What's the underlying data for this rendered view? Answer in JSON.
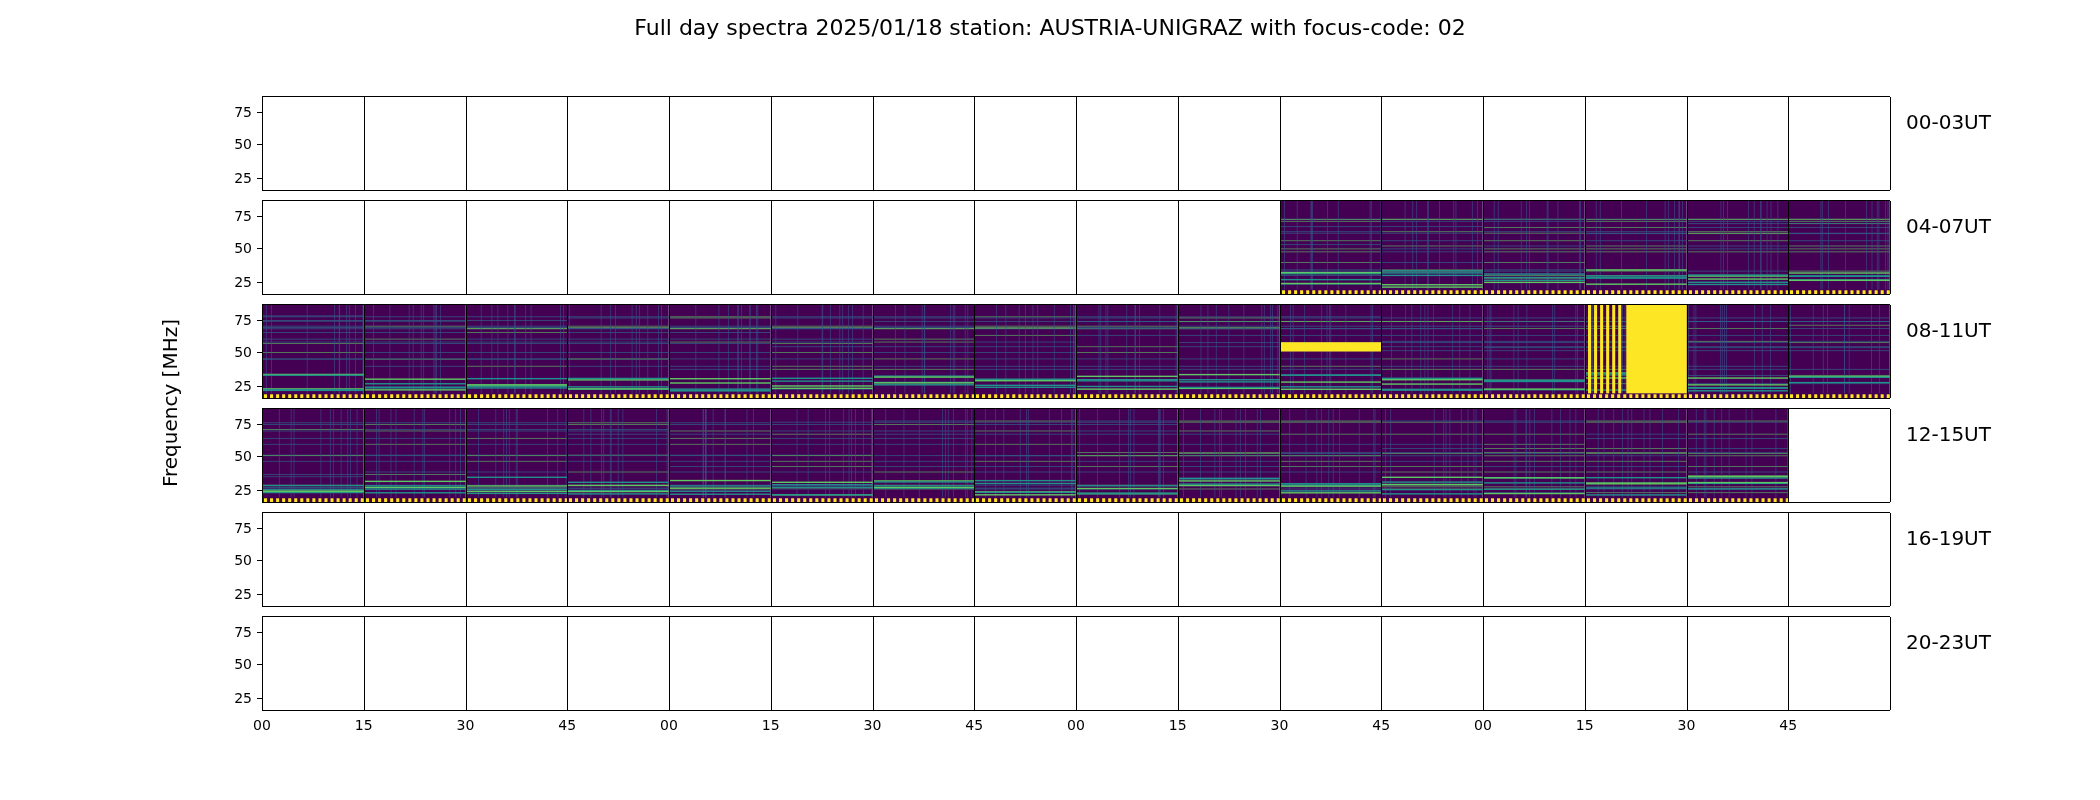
{
  "title": "Full day spectra 2025/01/18 station: AUSTRIA-UNIGRAZ with focus-code: 02",
  "ylabel": "Frequency [MHz]",
  "rows": [
    {
      "label": "00-03UT",
      "yticks": [
        "75",
        "50",
        "25"
      ],
      "panels": [
        {
          "kind": "empty"
        },
        {
          "kind": "empty"
        },
        {
          "kind": "empty"
        },
        {
          "kind": "empty"
        },
        {
          "kind": "empty"
        },
        {
          "kind": "empty"
        },
        {
          "kind": "empty"
        },
        {
          "kind": "empty"
        },
        {
          "kind": "empty"
        },
        {
          "kind": "empty"
        },
        {
          "kind": "empty"
        },
        {
          "kind": "empty"
        },
        {
          "kind": "empty"
        },
        {
          "kind": "empty"
        },
        {
          "kind": "empty"
        },
        {
          "kind": "empty"
        }
      ]
    },
    {
      "label": "04-07UT",
      "yticks": [
        "75",
        "50",
        "25"
      ],
      "panels": [
        {
          "kind": "empty"
        },
        {
          "kind": "empty"
        },
        {
          "kind": "empty"
        },
        {
          "kind": "empty"
        },
        {
          "kind": "empty"
        },
        {
          "kind": "empty"
        },
        {
          "kind": "empty"
        },
        {
          "kind": "empty"
        },
        {
          "kind": "empty"
        },
        {
          "kind": "empty"
        },
        {
          "kind": "spectrum"
        },
        {
          "kind": "spectrum"
        },
        {
          "kind": "spectrum"
        },
        {
          "kind": "spectrum"
        },
        {
          "kind": "spectrum"
        },
        {
          "kind": "spectrum"
        }
      ]
    },
    {
      "label": "08-11UT",
      "yticks": [
        "75",
        "50",
        "25"
      ],
      "panels": [
        {
          "kind": "spectrum"
        },
        {
          "kind": "spectrum"
        },
        {
          "kind": "spectrum"
        },
        {
          "kind": "spectrum"
        },
        {
          "kind": "spectrum"
        },
        {
          "kind": "spectrum"
        },
        {
          "kind": "spectrum"
        },
        {
          "kind": "spectrum"
        },
        {
          "kind": "spectrum"
        },
        {
          "kind": "spectrum"
        },
        {
          "kind": "band"
        },
        {
          "kind": "spectrum"
        },
        {
          "kind": "spectrum"
        },
        {
          "kind": "saturated"
        },
        {
          "kind": "spectrum"
        },
        {
          "kind": "spectrum"
        }
      ]
    },
    {
      "label": "12-15UT",
      "yticks": [
        "75",
        "50",
        "25"
      ],
      "panels": [
        {
          "kind": "spectrum"
        },
        {
          "kind": "spectrum"
        },
        {
          "kind": "spectrum"
        },
        {
          "kind": "spectrum"
        },
        {
          "kind": "spectrum"
        },
        {
          "kind": "spectrum"
        },
        {
          "kind": "spectrum"
        },
        {
          "kind": "spectrum"
        },
        {
          "kind": "spectrum"
        },
        {
          "kind": "spectrum"
        },
        {
          "kind": "spectrum"
        },
        {
          "kind": "spectrum"
        },
        {
          "kind": "spectrum"
        },
        {
          "kind": "spectrum"
        },
        {
          "kind": "spectrum"
        },
        {
          "kind": "empty"
        }
      ]
    },
    {
      "label": "16-19UT",
      "yticks": [
        "75",
        "50",
        "25"
      ],
      "panels": [
        {
          "kind": "empty"
        },
        {
          "kind": "empty"
        },
        {
          "kind": "empty"
        },
        {
          "kind": "empty"
        },
        {
          "kind": "empty"
        },
        {
          "kind": "empty"
        },
        {
          "kind": "empty"
        },
        {
          "kind": "empty"
        },
        {
          "kind": "empty"
        },
        {
          "kind": "empty"
        },
        {
          "kind": "empty"
        },
        {
          "kind": "empty"
        },
        {
          "kind": "empty"
        },
        {
          "kind": "empty"
        },
        {
          "kind": "empty"
        },
        {
          "kind": "empty"
        }
      ]
    },
    {
      "label": "20-23UT",
      "yticks": [
        "75",
        "50",
        "25"
      ],
      "panels": [
        {
          "kind": "empty"
        },
        {
          "kind": "empty"
        },
        {
          "kind": "empty"
        },
        {
          "kind": "empty"
        },
        {
          "kind": "empty"
        },
        {
          "kind": "empty"
        },
        {
          "kind": "empty"
        },
        {
          "kind": "empty"
        },
        {
          "kind": "empty"
        },
        {
          "kind": "empty"
        },
        {
          "kind": "empty"
        },
        {
          "kind": "empty"
        },
        {
          "kind": "empty"
        },
        {
          "kind": "empty"
        },
        {
          "kind": "empty"
        },
        {
          "kind": "empty"
        }
      ]
    }
  ],
  "xticks": [
    "00",
    "15",
    "30",
    "45",
    "00",
    "15",
    "30",
    "45",
    "00",
    "15",
    "30",
    "45",
    "00",
    "15",
    "30",
    "45"
  ]
}
